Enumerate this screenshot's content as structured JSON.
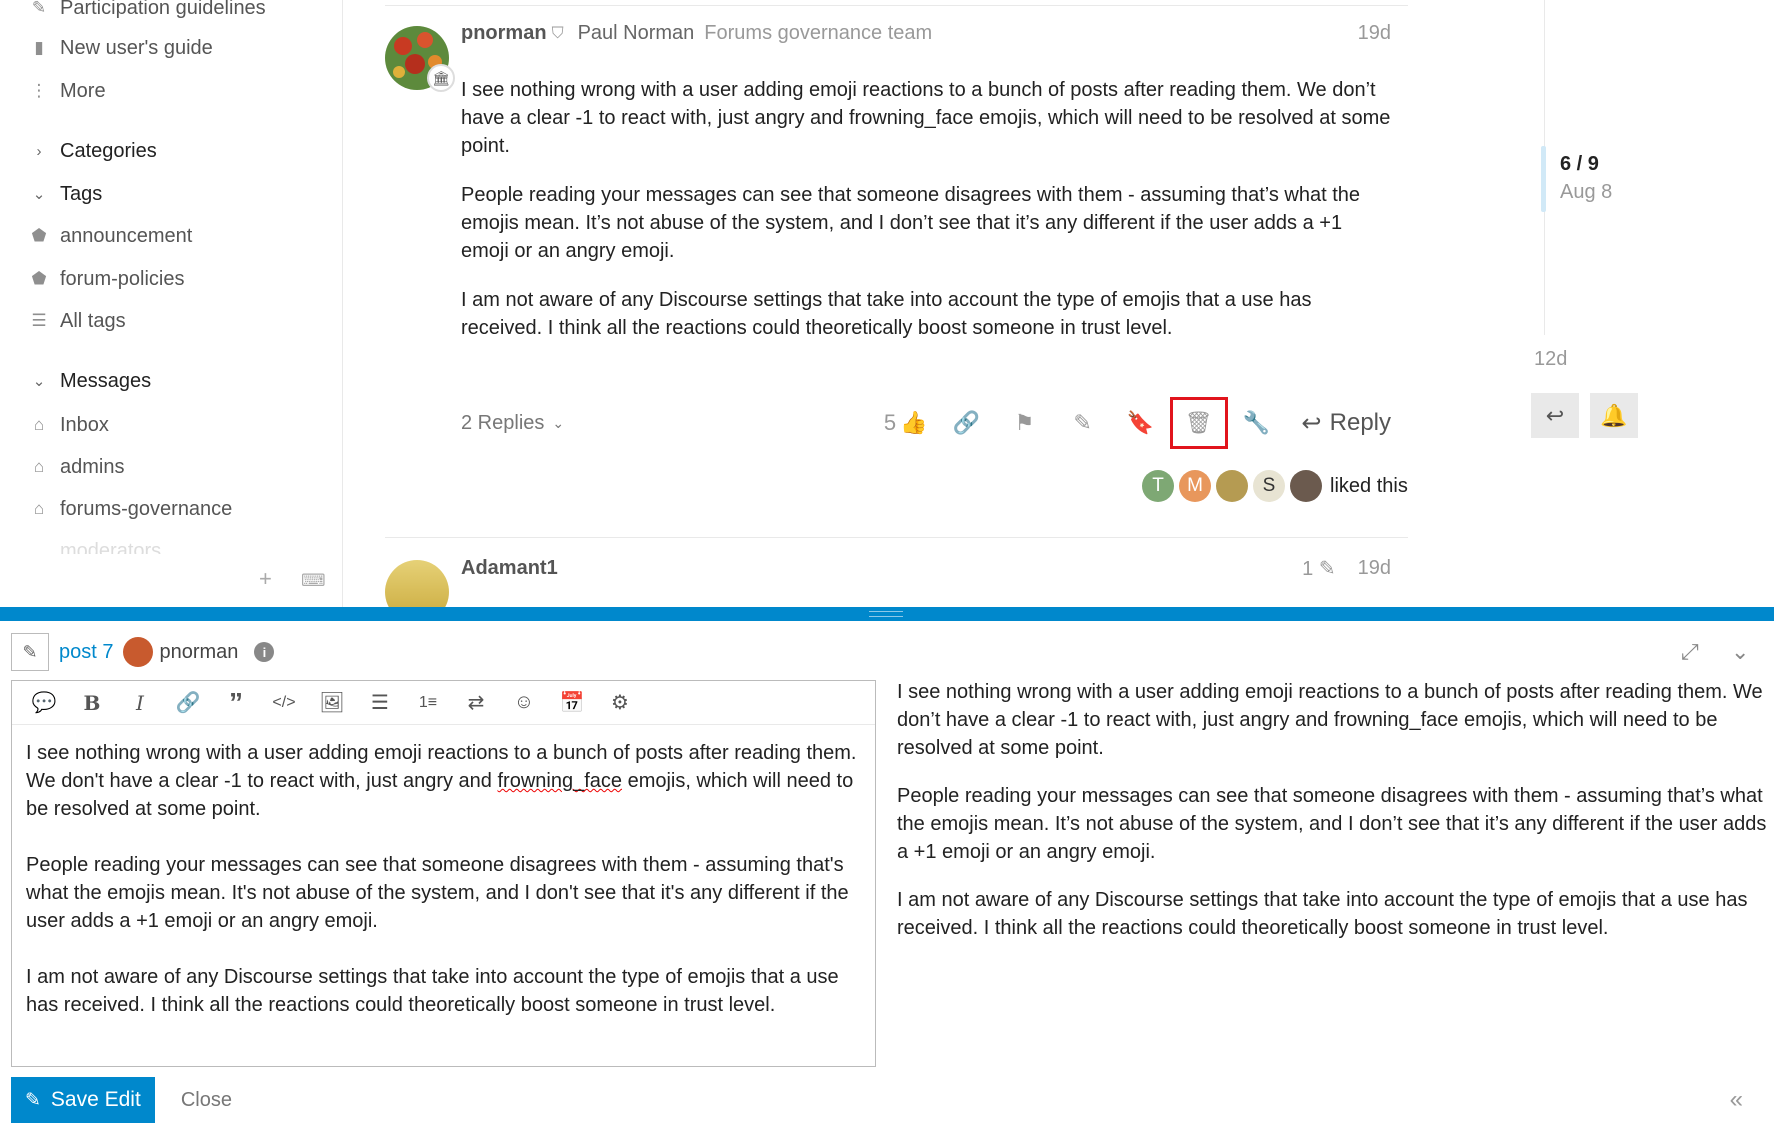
{
  "sidebar": {
    "links": [
      {
        "label": "Participation guidelines",
        "icon": "guidelines-icon"
      },
      {
        "label": "New user's guide",
        "icon": "book-icon"
      },
      {
        "label": "More",
        "icon": "more-vertical-icon"
      }
    ],
    "categories_label": "Categories",
    "tags_label": "Tags",
    "tags": [
      "announcement",
      "forum-policies"
    ],
    "all_tags_label": "All tags",
    "messages_label": "Messages",
    "messages": [
      "Inbox",
      "admins",
      "forums-governance"
    ],
    "faded_item": "moderators"
  },
  "post": {
    "username": "pnorman",
    "full_name": "Paul Norman",
    "user_title": "Forums governance team",
    "date": "19d",
    "paragraphs": [
      "I see nothing wrong with a user adding emoji reactions to a bunch of posts after reading them. We don’t have a clear -1 to react with, just angry and frowning_face emojis, which will need to be resolved at some point.",
      "People reading your messages can see that someone disagrees with them - assuming that’s what the emojis mean. It’s not abuse of the system, and I don’t see that it’s any different if the user adds a +1 emoji or an angry emoji.",
      "I am not aware of any Discourse settings that take into account the type of emojis that a use has received. I think all the reactions could theoretically boost someone in trust level."
    ],
    "replies_label": "2 Replies",
    "like_count": "5",
    "reply_label": "Reply",
    "liked_label": "liked this",
    "likers": [
      {
        "initial": "T",
        "color": "#7ea874"
      },
      {
        "initial": "M",
        "color": "#e8975c"
      },
      {
        "initial": "",
        "color": "#b59b52"
      },
      {
        "initial": "S",
        "color": "#e8e4d3"
      },
      {
        "initial": "",
        "color": "#6b5a4e"
      }
    ]
  },
  "next_post": {
    "username": "Adamant1",
    "edit_count": "1",
    "date": "19d"
  },
  "timeline": {
    "position": "6 / 9",
    "date": "Aug 8",
    "last_date": "12d"
  },
  "composer": {
    "post_link": "post 7",
    "username": "pnorman",
    "editor_text_before": "I see nothing wrong with a user adding emoji reactions to a bunch of posts after reading them. We don't have a clear -1 to react with, just angry and ",
    "editor_text_misspelled": "frowning_face",
    "editor_text_after": " emojis, which will need to be resolved at some point.\n\nPeople reading your messages can see that someone disagrees with them - assuming that's what the emojis mean. It's not abuse of the system, and I don't see that it's any different if the user adds a +1 emoji or an angry emoji.\n\nI am not aware of any Discourse settings that take into account the type of emojis that a use has received. I think all the reactions could theoretically boost someone in trust level.",
    "preview_paragraphs": [
      "I see nothing wrong with a user adding emoji reactions to a bunch of posts after reading them. We don’t have a clear -1 to react with, just angry and frowning_face emojis, which will need to be resolved at some point.",
      "People reading your messages can see that someone disagrees with them - assuming that’s what the emojis mean. It’s not abuse of the system, and I don’t see that it’s any different if the user adds a +1 emoji or an angry emoji.",
      "I am not aware of any Discourse settings that take into account the type of emojis that a use has received. I think all the reactions could theoretically boost someone in trust level."
    ],
    "save_label": "Save Edit",
    "close_label": "Close"
  },
  "colors": {
    "accent": "#0088cc",
    "highlight_box": "#e1141c",
    "tertiary_bg": "#e9e9e9"
  }
}
